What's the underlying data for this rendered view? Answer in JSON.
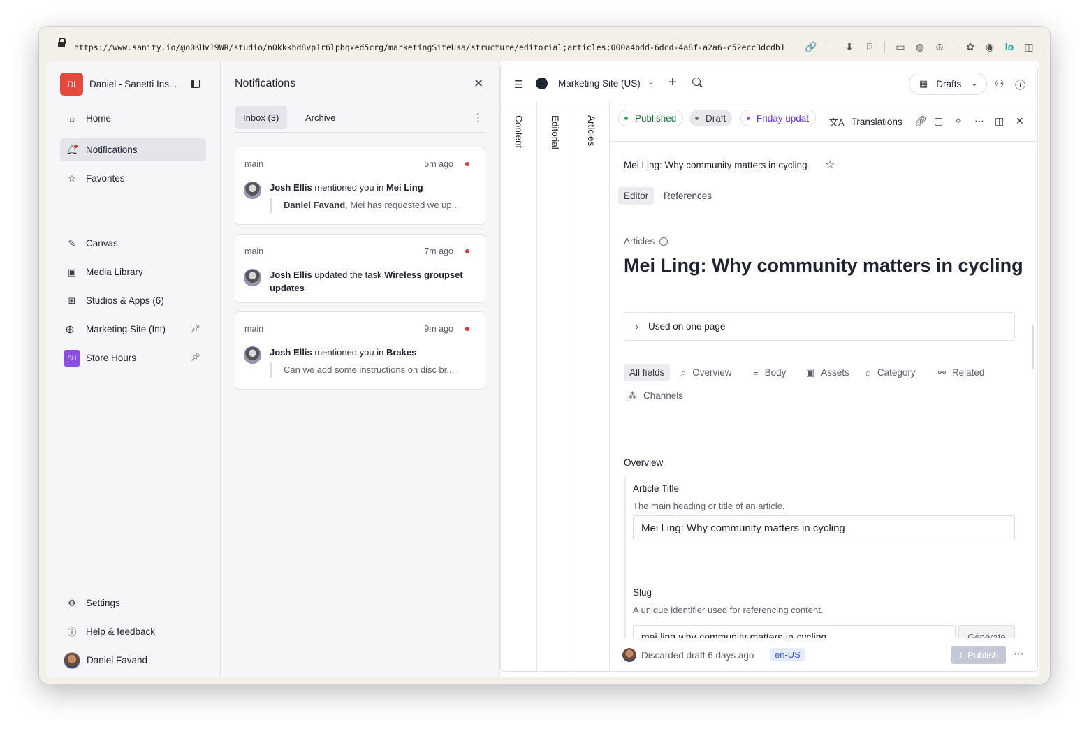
{
  "browser": {
    "url": "https://www.sanity.io/@o0KHv19WR/studio/n0kkkhd8vp1r6lpbqxed5crg/marketingSiteUsa/structure/editorial;articles;000a4bdd-6dcd-4a8f-a2a6-c52ecc3dcdb1"
  },
  "sidebar": {
    "workspace_badge": "DI",
    "workspace_name": "Daniel - Sanetti Ins...",
    "nav": {
      "home": "Home",
      "notifications": "Notifications",
      "favorites": "Favorites",
      "canvas": "Canvas",
      "media_library": "Media Library",
      "studios_apps": "Studios & Apps (6)",
      "marketing_site": "Marketing Site (Int)",
      "store_hours": "Store Hours",
      "store_hours_badge": "SH"
    },
    "bottom": {
      "settings": "Settings",
      "help": "Help & feedback",
      "user": "Daniel Favand"
    }
  },
  "notifications": {
    "title": "Notifications",
    "tabs": {
      "inbox": "Inbox (3)",
      "archive": "Archive"
    },
    "items": [
      {
        "branch": "main",
        "time": "5m ago",
        "actor": "Josh Ellis",
        "action": "mentioned you in",
        "target": "Mei Ling",
        "quote_author": "Daniel Favand",
        "quote": ", Mei has requested we up..."
      },
      {
        "branch": "main",
        "time": "7m ago",
        "actor": "Josh Ellis",
        "action": "updated the task",
        "target": "Wireless groupset updates"
      },
      {
        "branch": "main",
        "time": "9m ago",
        "actor": "Josh Ellis",
        "action": "mentioned you in",
        "target": "Brakes",
        "quote": "Can we add some instructions on disc br..."
      }
    ]
  },
  "main": {
    "site": "Marketing Site (US)",
    "perspective": "Drafts",
    "panes": {
      "content": "Content",
      "editorial": "Editorial",
      "articles": "Articles"
    },
    "doc": {
      "status": {
        "published": "Published",
        "draft": "Draft",
        "release": "Friday updat"
      },
      "translations": "Translations",
      "title_crumb": "Mei Ling: Why community matters in cycling",
      "tabs": {
        "editor": "Editor",
        "references": "References"
      },
      "type": "Articles",
      "heading": "Mei Ling: Why community matters in cycling",
      "used_on": "Used on one page",
      "field_groups": {
        "all": "All fields",
        "overview": "Overview",
        "body": "Body",
        "assets": "Assets",
        "category": "Category",
        "related": "Related",
        "channels": "Channels"
      },
      "section": "Overview",
      "article_title": {
        "label": "Article Title",
        "description": "The main heading or title of an article.",
        "value": "Mei Ling: Why community matters in cycling"
      },
      "slug": {
        "label": "Slug",
        "description": "A unique identifier used for referencing content.",
        "value": "mei-ling-why-community-matters-in-cycling",
        "generate": "Generate"
      },
      "footer": {
        "status": "Discarded draft 6 days ago",
        "locale": "en-US",
        "publish": "Publish"
      }
    }
  }
}
